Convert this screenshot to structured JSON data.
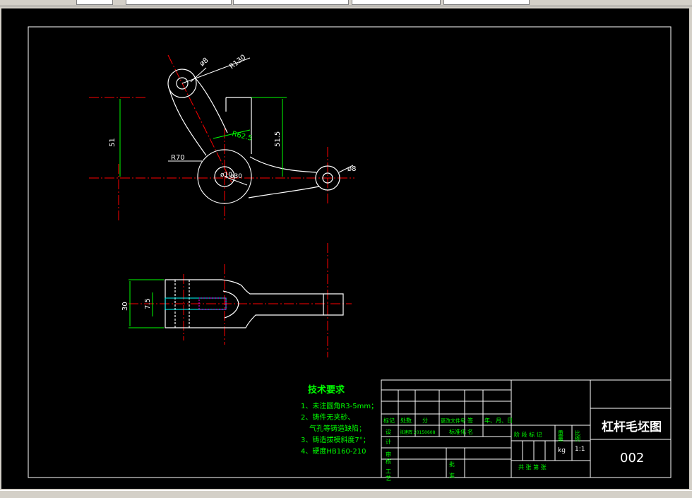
{
  "colors": {
    "background": "#000000",
    "outline": "#ffffff",
    "centerline": "#ff0000",
    "dimension": "#00ff00",
    "hidden": "#00ffff",
    "hatch": "#ff00ff"
  },
  "dimensions": {
    "phi8_top": "ø8",
    "r130": "R130",
    "d51": "51",
    "d515": "51.5",
    "r62": "R62.5",
    "r70": "R70",
    "phi10": "ø10",
    "phi30": "ø30",
    "phi8_right": "ø8",
    "d30": "30",
    "d75": "7.5"
  },
  "requirements": {
    "title": "技术要求",
    "items": [
      "1、未注圆角R3-5mm；",
      "2、铸件无夹砂、",
      "气孔等铸造缺陷；",
      "3、铸造拔模斜度7°；",
      "4、硬度HB160-210"
    ]
  },
  "title_block": {
    "drawing_title": "杠杆毛坯图",
    "drawing_number": "002",
    "hdr_biaoji": "标记",
    "hdr_chushu": "处数",
    "hdr_fenqu": "分",
    "hdr_gengai": "更改文件号",
    "hdr_qianming": "签",
    "hdr_date": "年、月、日",
    "row_she": "设",
    "row_std": "标准化",
    "row_ji": "计",
    "row_shen": "审",
    "row_he": "核",
    "row_gong": "工",
    "row_yi": "艺",
    "pi": "批",
    "zhun": "准",
    "sheji_name": "张建辉 20150608",
    "ming": "名",
    "stage_label": "阶 段 标 记",
    "weight_label": "重",
    "liang": "量",
    "scale_label": "比",
    "li": "例",
    "weight_unit": "kg",
    "scale_value": "1:1",
    "sheets": "共 张 第 张"
  }
}
